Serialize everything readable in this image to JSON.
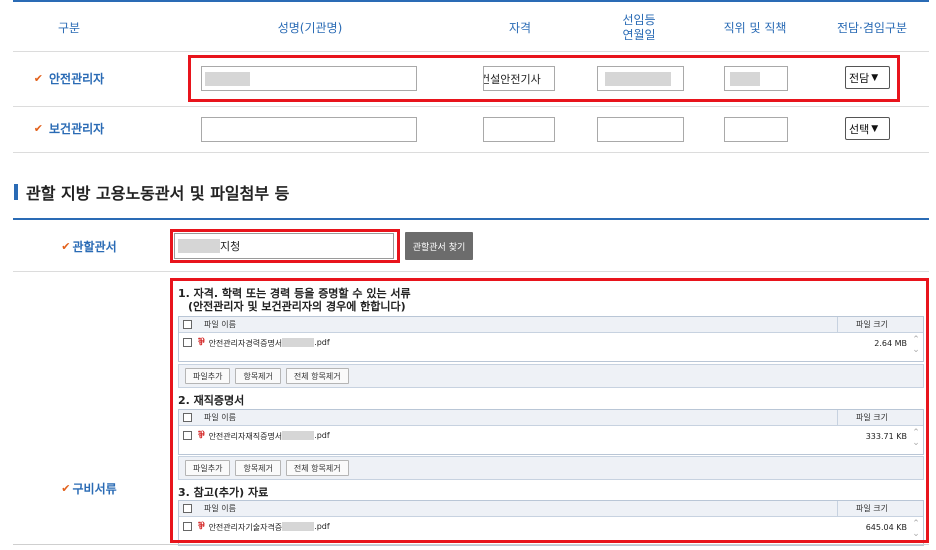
{
  "table_headers": [
    "구분",
    "성명(기관명)",
    "자격",
    "선임등\n연월일",
    "직위 및 직책",
    "전담·겸임구분"
  ],
  "rows": [
    {
      "label": "안전관리자",
      "name_value": "",
      "qual_value": "건설안전기사",
      "select_value": "전담"
    },
    {
      "label": "보건관리자",
      "name_value": "",
      "qual_value": "",
      "select_value": "선택"
    }
  ],
  "section": {
    "title": "관할 지방 고용노동관서 및 파일첨부 등"
  },
  "office": {
    "label": "관할관서",
    "value_suffix": "지청",
    "find_button": "관할관서 찾기"
  },
  "docs": {
    "label": "구비서류",
    "header_name": "파일 이름",
    "header_size": "파일 크기",
    "buttons": [
      "파일추가",
      "항목제거",
      "전체 항목제거"
    ],
    "groups": [
      {
        "title_line1": "1. 자격.  학력 또는 경력 등을 증명할 수 있는 서류",
        "title_line2": "(안전관리자 및 보건관리자의 경우에 한합니다)",
        "file_prefix": "안전관리자경력증명서",
        "file_suffix": ".pdf",
        "size": "2.64 MB"
      },
      {
        "title_line1": "2. 재직증명서",
        "title_line2": "",
        "file_prefix": "안전관리자재직증명서",
        "file_suffix": ".pdf",
        "size": "333.71 KB"
      },
      {
        "title_line1": "3. 참고(추가) 자료",
        "title_line2": "",
        "file_prefix": "안전관리자기술자격증",
        "file_suffix": ".pdf",
        "size": "645.04 KB"
      }
    ]
  },
  "colors": {
    "accent": "#2a6bb5",
    "check": "#e2601a",
    "highlight": "#e8141c"
  }
}
